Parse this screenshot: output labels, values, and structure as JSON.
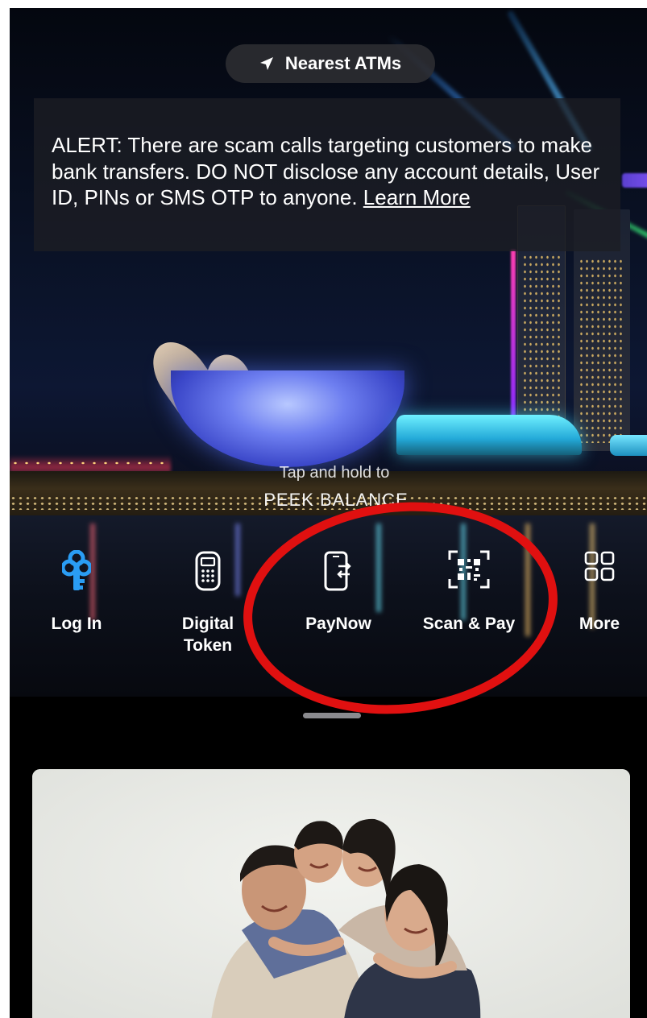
{
  "top_bar": {
    "nearest_atms_label": "Nearest ATMs",
    "icon": "location-arrow-icon"
  },
  "alert": {
    "text": "ALERT: There are scam calls targeting customers to make bank transfers. DO NOT disclose any account details, User ID, PINs or SMS OTP to anyone.",
    "link_text": "Learn More"
  },
  "peek_balance": {
    "line1": "Tap and hold to",
    "line2": "PEEK BALANCE"
  },
  "actions": [
    {
      "label": "Log In",
      "icon": "key-icon"
    },
    {
      "label": "Digital Token",
      "icon": "token-device-icon"
    },
    {
      "label": "PayNow",
      "icon": "phone-transfer-icon"
    },
    {
      "label": "Scan & Pay",
      "icon": "qr-scan-icon"
    },
    {
      "label": "More",
      "icon": "grid-icon"
    }
  ],
  "colors": {
    "key_icon": "#2a9df4",
    "annotation_ring": "#e01010",
    "card_background": "#eceeea"
  }
}
